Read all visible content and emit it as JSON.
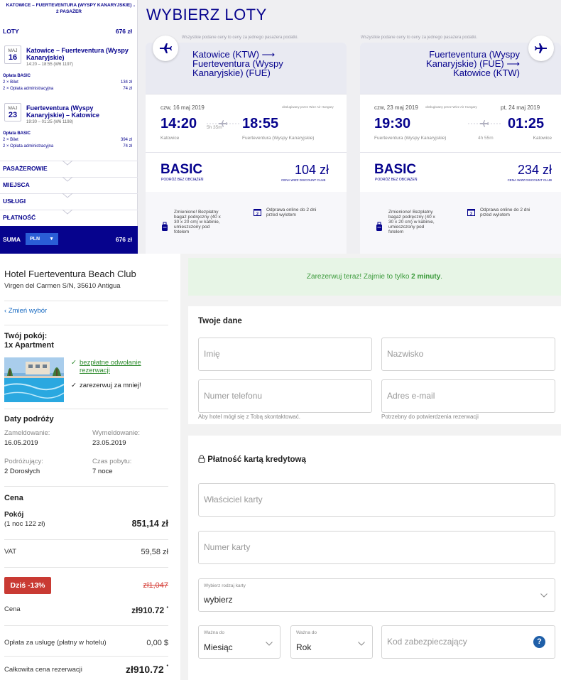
{
  "sidebar": {
    "route_title": "KATOWICE – FUERTEVENTURA (WYSPY KANARYJSKIE)",
    "passengers": "2 PASAŻER",
    "loty_label": "LOTY",
    "loty_total": "676 zł",
    "leg1": {
      "month": "MAJ",
      "day": "16",
      "title": "Katowice – Fuerteventura (Wyspy Kanaryjskie)",
      "time": "14:20 – 18:55 (W6 1197)",
      "fee_header": "Opłata BASIC",
      "fee1_label": "2 × Bilet",
      "fee1_amount": "134 zł",
      "fee2_label": "2 × Opłata administracyjna",
      "fee2_amount": "74 zł"
    },
    "leg2": {
      "month": "MAJ",
      "day": "23",
      "title": "Fuerteventura (Wyspy Kanaryjskie) – Katowice",
      "time": "19:30 – 01:25 (W6 1198)",
      "fee_header": "Opłata BASIC",
      "fee1_label": "2 × Bilet",
      "fee1_amount": "394 zł",
      "fee2_label": "2 × Opłata administracyjna",
      "fee2_amount": "74 zł"
    },
    "sections": [
      "PASAŻEROWIE",
      "MIEJSCA",
      "USŁUGI",
      "PŁATNOŚĆ"
    ],
    "suma_label": "SUMA",
    "currency": "PLN",
    "suma_total": "676 zł"
  },
  "flights": {
    "page_title": "WYBIERZ LOTY",
    "notice": "Wszystkie podane ceny to ceny za jednego pasażera podatki.",
    "notice2": "Wszystkie podane ceny to ceny za jednego pasażera podatki.",
    "outbound": {
      "route": [
        "Katowice (KTW) ⟶",
        "Fuerteventura (Wyspy",
        "Kanaryjskie) (FUE)"
      ],
      "date": "czw, 16 maj 2019",
      "operator": "obsługiwany przez Wizz Air Hungary",
      "dep_time": "14:20",
      "arr_time": "18:55",
      "duration": "5h 35m",
      "dep_airport": "Katowice",
      "arr_airport": "Fuerteventura (Wyspy Kanaryjskie)",
      "fare": "BASIC",
      "fare_sub": "PODRÓŻ BEZ OBCIĄŻEŃ",
      "price": "104 zł",
      "price_sub": "CENA WIZZ DISCOUNT CLUB",
      "bag_text": [
        "Zmienione! Bezpłatny",
        "bagaż podręczny (40 x",
        "30 x 20 cm) w kabinie,",
        "umieszczony pod",
        "fotelem"
      ],
      "checkin_text": [
        "Odprawa online do 2 dni",
        "przed wylotem"
      ]
    },
    "return": {
      "route": [
        "Fuerteventura (Wyspy",
        "Kanaryjskie) (FUE) ⟶",
        "Katowice (KTW)"
      ],
      "date": "czw, 23 maj 2019",
      "operator": "obsługiwany przez Wizz Air Hungary",
      "arr_date": "pt, 24 maj 2019",
      "dep_time": "19:30",
      "arr_time": "01:25",
      "duration": "4h 55m",
      "dep_airport": "Fuerteventura (Wyspy Kanaryjskie)",
      "arr_airport": "Katowice",
      "fare": "BASIC",
      "fare_sub": "PODRÓŻ BEZ OBCIĄŻEŃ",
      "price": "234 zł",
      "price_sub": "CENA WIZZ DISCOUNT CLUB",
      "bag_text": [
        "Zmienione! Bezpłatny",
        "bagaż podręczny (40 x",
        "30 x 20 cm) w kabinie,",
        "umieszczony pod",
        "fotelem"
      ],
      "checkin_text": [
        "Odprawa online do 2 dni",
        "przed wylotem"
      ]
    }
  },
  "hotel": {
    "name": "Hotel Fuerteventura Beach Club",
    "address": "Virgen del Carmen S/N, 35610 Antigua",
    "change_link": "Zmień wybór",
    "room_title": "Twój pokój:",
    "room_type": "1x Apartment",
    "perk1": [
      "bezpłatne odwołanie",
      "rezerwacji"
    ],
    "perk2": "zarezerwuj za mniej!",
    "dates_title": "Daty podróży",
    "checkin_label": "Zameldowanie:",
    "checkin_value": "16.05.2019",
    "checkout_label": "Wymeldowanie:",
    "checkout_value": "23.05.2019",
    "travelers_label": "Podróżujący:",
    "travelers_value": "2 Dorosłych",
    "stay_label": "Czas pobytu:",
    "stay_value": "7 noce",
    "price_title": "Cena",
    "room_label": "Pokój",
    "room_per_night": "(1 noc 122 zł)",
    "room_price": "851,14 zł",
    "vat_label": "VAT",
    "vat_value": "59,58 zł",
    "discount_badge": "Dziś -13%",
    "old_price": "zł1,047",
    "cena_label": "Cena",
    "cena_value": "zł910.72",
    "service_label": "Opłata za usługę (płatny w hotelu)",
    "service_value": "0,00 $",
    "total_label": "Całkowita cena rezerwacji",
    "total_value": "zł910.72"
  },
  "form": {
    "banner_text": "Zarezerwuj teraz! Zajmie to tylko ",
    "banner_bold": "2 minuty",
    "banner_end": ".",
    "your_data_title": "Twoje dane",
    "first_name_ph": "Imię",
    "last_name_ph": "Nazwisko",
    "phone_ph": "Numer telefonu",
    "email_ph": "Adres e-mail",
    "phone_hint": "Aby hotel mógł się z Tobą skontaktować.",
    "email_hint": "Potrzebny do potwierdzenia rezerwacji",
    "payment_title": "Płatność kartą kredytową",
    "card_owner_ph": "Właściciel karty",
    "card_number_ph": "Numer karty",
    "card_type_label": "Wybierz rodzaj karty",
    "card_type_value": "wybierz",
    "valid_label": "Ważna do",
    "month_value": "Miesiąc",
    "year_value": "Rok",
    "cvv_ph": "Kod zabezpieczający",
    "help_glyph": "?"
  },
  "colors": {
    "wizz_navy": "#06038d",
    "wizz_blue": "#2a5dd6",
    "discount_red": "#c93a33",
    "success_green": "#3a9a3a",
    "link_blue": "#1669c1"
  }
}
